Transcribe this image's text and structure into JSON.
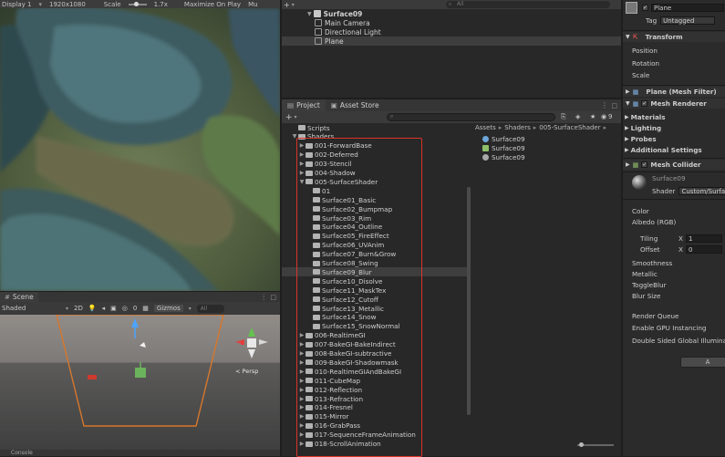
{
  "game": {
    "display": "Display 1",
    "resolution": "1920x1080",
    "scale_label": "Scale",
    "scale_value": "1.7x",
    "maximize": "Maximize On Play",
    "mute": "Mu"
  },
  "hierarchy": {
    "search_placeholder": "All",
    "root": "Surface09",
    "children": [
      "Main Camera",
      "Directional Light",
      "Plane"
    ]
  },
  "project": {
    "tab_project": "Project",
    "tab_asset_store": "Asset Store",
    "hidden_count": "9",
    "tree": [
      {
        "label": "Scripts",
        "level": 1,
        "arrow": ""
      },
      {
        "label": "Shaders",
        "level": 1,
        "arrow": "▼"
      },
      {
        "label": "001-ForwardBase",
        "level": 2,
        "arrow": "▶"
      },
      {
        "label": "002-Deferred",
        "level": 2,
        "arrow": "▶"
      },
      {
        "label": "003-Stencil",
        "level": 2,
        "arrow": "▶"
      },
      {
        "label": "004-Shadow",
        "level": 2,
        "arrow": "▶"
      },
      {
        "label": "005-SurfaceShader",
        "level": 2,
        "arrow": "▼"
      },
      {
        "label": "01",
        "level": 3,
        "arrow": ""
      },
      {
        "label": "Surface01_Basic",
        "level": 3,
        "arrow": ""
      },
      {
        "label": "Surface02_Bumpmap",
        "level": 3,
        "arrow": ""
      },
      {
        "label": "Surface03_Rim",
        "level": 3,
        "arrow": ""
      },
      {
        "label": "Surface04_Outline",
        "level": 3,
        "arrow": ""
      },
      {
        "label": "Surface05_FireEffect",
        "level": 3,
        "arrow": ""
      },
      {
        "label": "Surface06_UVAnim",
        "level": 3,
        "arrow": ""
      },
      {
        "label": "Surface07_Burn&Grow",
        "level": 3,
        "arrow": ""
      },
      {
        "label": "Surface08_Swing",
        "level": 3,
        "arrow": ""
      },
      {
        "label": "Surface09_Blur",
        "level": 3,
        "arrow": "",
        "selected": true
      },
      {
        "label": "Surface10_Disolve",
        "level": 3,
        "arrow": ""
      },
      {
        "label": "Surface11_MaskTex",
        "level": 3,
        "arrow": ""
      },
      {
        "label": "Surface12_Cutoff",
        "level": 3,
        "arrow": ""
      },
      {
        "label": "Surface13_Metallic",
        "level": 3,
        "arrow": ""
      },
      {
        "label": "Surface14_Snow",
        "level": 3,
        "arrow": ""
      },
      {
        "label": "Surface15_SnowNormal",
        "level": 3,
        "arrow": ""
      },
      {
        "label": "006-RealtimeGI",
        "level": 2,
        "arrow": "▶"
      },
      {
        "label": "007-BakeGI-BakeIndirect",
        "level": 2,
        "arrow": "▶"
      },
      {
        "label": "008-BakeGI-subtractive",
        "level": 2,
        "arrow": "▶"
      },
      {
        "label": "009-BakeGI-Shadowmask",
        "level": 2,
        "arrow": "▶"
      },
      {
        "label": "010-RealtimeGIAndBakeGI",
        "level": 2,
        "arrow": "▶"
      },
      {
        "label": "011-CubeMap",
        "level": 2,
        "arrow": "▶"
      },
      {
        "label": "012-Reflection",
        "level": 2,
        "arrow": "▶"
      },
      {
        "label": "013-Refraction",
        "level": 2,
        "arrow": "▶"
      },
      {
        "label": "014-Fresnel",
        "level": 2,
        "arrow": "▶"
      },
      {
        "label": "015-Mirror",
        "level": 2,
        "arrow": "▶"
      },
      {
        "label": "016-GrabPass",
        "level": 2,
        "arrow": "▶"
      },
      {
        "label": "017-SequenceFrameAnimation",
        "level": 2,
        "arrow": "▶"
      },
      {
        "label": "018-ScrollAnimation",
        "level": 2,
        "arrow": "▶"
      }
    ],
    "breadcrumb": [
      "Assets",
      "Shaders",
      "005-SurfaceShader"
    ],
    "assets": [
      {
        "label": "Surface09",
        "icon": "material-sphere-icon",
        "color": "#6ea6d8"
      },
      {
        "label": "Surface09",
        "icon": "shader-file-icon",
        "color": "#8fbf6a"
      },
      {
        "label": "Surface09",
        "icon": "material-sphere-icon",
        "color": "#a9a9a9"
      }
    ]
  },
  "scene": {
    "tab": "Scene",
    "shading": "Shaded",
    "mode_2d": "2D",
    "hidden_count": "0",
    "gizmos": "Gizmos",
    "search_placeholder": "All",
    "persp": "< Persp"
  },
  "bottom": {
    "tab": "Console"
  },
  "inspector": {
    "object_name": "Plane",
    "tag_label": "Tag",
    "tag_value": "Untagged",
    "transform": "Transform",
    "position": "Position",
    "rotation": "Rotation",
    "scale": "Scale",
    "mesh_filter": "Plane (Mesh Filter)",
    "mesh_renderer": "Mesh Renderer",
    "materials": "Materials",
    "lighting": "Lighting",
    "probes": "Probes",
    "additional": "Additional Settings",
    "mesh_collider": "Mesh Collider",
    "material_name": "Surface09",
    "shader_label": "Shader",
    "shader_value": "Custom/Surfa",
    "color": "Color",
    "albedo": "Albedo (RGB)",
    "tiling": "Tiling",
    "offset": "Offset",
    "x_label": "X",
    "tiling_x": "1",
    "offset_x": "0",
    "smoothness": "Smoothness",
    "metallic": "Metallic",
    "toggle_blur": "ToggleBlur",
    "blur_size": "Blur Size",
    "render_queue": "Render Queue",
    "gpu_instancing": "Enable GPU Instancing",
    "double_sided": "Double Sided Global Illuminatio",
    "add_component": "A"
  }
}
